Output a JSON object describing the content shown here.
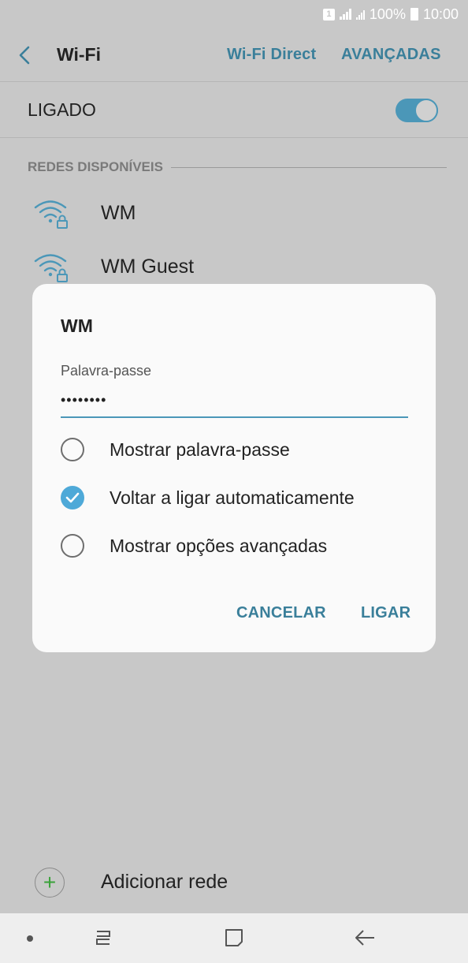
{
  "status_bar": {
    "sim_badge": "1",
    "battery": "100%",
    "time": "10:00"
  },
  "toolbar": {
    "title": "Wi-Fi",
    "wifi_direct": "Wi-Fi Direct",
    "advanced": "AVANÇADAS"
  },
  "master_switch": {
    "label": "LIGADO",
    "on": true
  },
  "section": {
    "header": "REDES DISPONÍVEIS"
  },
  "networks": [
    {
      "name": "WM",
      "icon": "wifi-lock-icon"
    },
    {
      "name": "WM Guest",
      "icon": "wifi-lock-icon"
    }
  ],
  "add_network": {
    "label": "Adicionar rede",
    "icon": "plus-circle-icon"
  },
  "dialog": {
    "title": "WM",
    "password_label": "Palavra-passe",
    "password_value": "••••••••",
    "options": [
      {
        "label": "Mostrar palavra-passe",
        "checked": false
      },
      {
        "label": "Voltar a ligar automaticamente",
        "checked": true
      },
      {
        "label": "Mostrar opções avançadas",
        "checked": false
      }
    ],
    "cancel": "CANCELAR",
    "connect": "LIGAR"
  },
  "colors": {
    "accent": "#3a7f9a",
    "toggle": "#4b97b8",
    "check": "#4ea9d8",
    "scrim_background": "#c8c8c8"
  }
}
